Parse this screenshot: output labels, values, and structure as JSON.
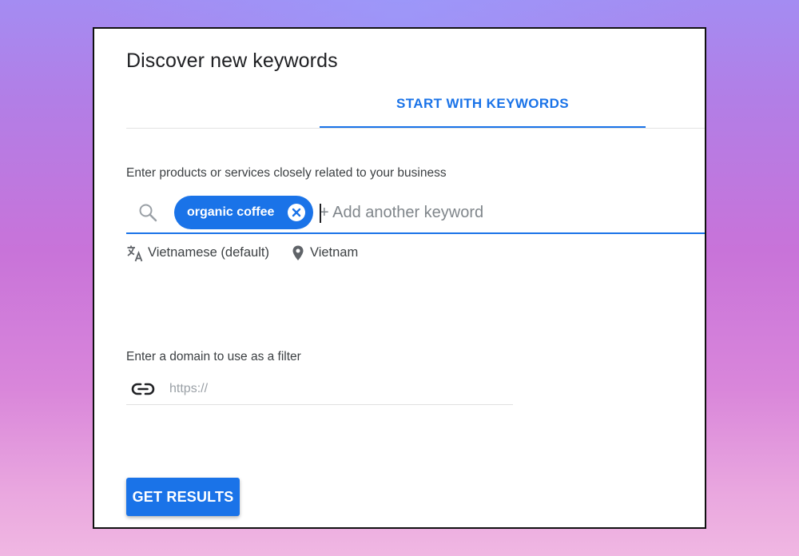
{
  "page": {
    "title": "Discover new keywords"
  },
  "tabs": [
    {
      "label": "START WITH KEYWORDS",
      "active": true
    }
  ],
  "keywords_section": {
    "label": "Enter products or services closely related to your business",
    "chips": [
      {
        "label": "organic coffee"
      }
    ],
    "input_placeholder": "+ Add another keyword",
    "search_icon": "search-icon",
    "chip_close_icon": "close-circle-icon"
  },
  "settings": {
    "language": {
      "label": "Vietnamese (default)",
      "icon": "translate-icon"
    },
    "location": {
      "label": "Vietnam",
      "icon": "location-pin-icon"
    }
  },
  "domain_section": {
    "label": "Enter a domain to use as a filter",
    "input_placeholder": "https://",
    "input_value": "",
    "icon": "link-icon"
  },
  "actions": {
    "get_results_label": "GET RESULTS"
  },
  "colors": {
    "accent": "#1a73e8",
    "text_primary": "#202124",
    "text_secondary": "#3c4043",
    "placeholder": "#80868b"
  }
}
